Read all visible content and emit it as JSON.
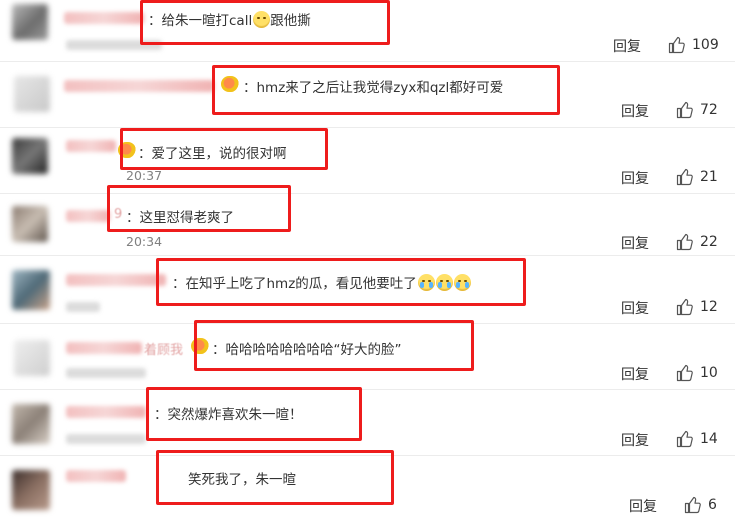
{
  "colors": {
    "highlight_border": "#ee1c1c",
    "text": "#333333",
    "meta": "#808080"
  },
  "icons": {
    "like": "thumbs-up-icon",
    "vip": "vip-crown-icon",
    "emoji": "emoji-icon"
  },
  "comments": [
    {
      "text": "：给朱一暄打call",
      "after_emoji": "跟他撕",
      "time": "",
      "reply": "回复",
      "likes": "109"
    },
    {
      "text": "：hmz来了之后让我觉得zyx和qzl都好可爱",
      "time": "",
      "reply": "回复",
      "likes": "72"
    },
    {
      "text": "：爱了这里，说的很对啊",
      "time": "20:37",
      "reply": "回复",
      "likes": "21"
    },
    {
      "name_tail": "9",
      "text": "：这里怼得老爽了",
      "time": "20:34",
      "reply": "回复",
      "likes": "22"
    },
    {
      "text": "：在知乎上吃了hmz的瓜，看见他要吐了",
      "time": "",
      "reply": "回复",
      "likes": "12"
    },
    {
      "name_tail": "着顾我",
      "text": "：哈哈哈哈哈哈哈哈“好大的脸”",
      "time": "",
      "reply": "回复",
      "likes": "10"
    },
    {
      "text": "：突然爆炸喜欢朱一暄！",
      "time": "",
      "reply": "回复",
      "likes": "14"
    },
    {
      "text": "笑死我了，朱一暄",
      "time": "",
      "reply": "回复",
      "likes": "6"
    }
  ]
}
